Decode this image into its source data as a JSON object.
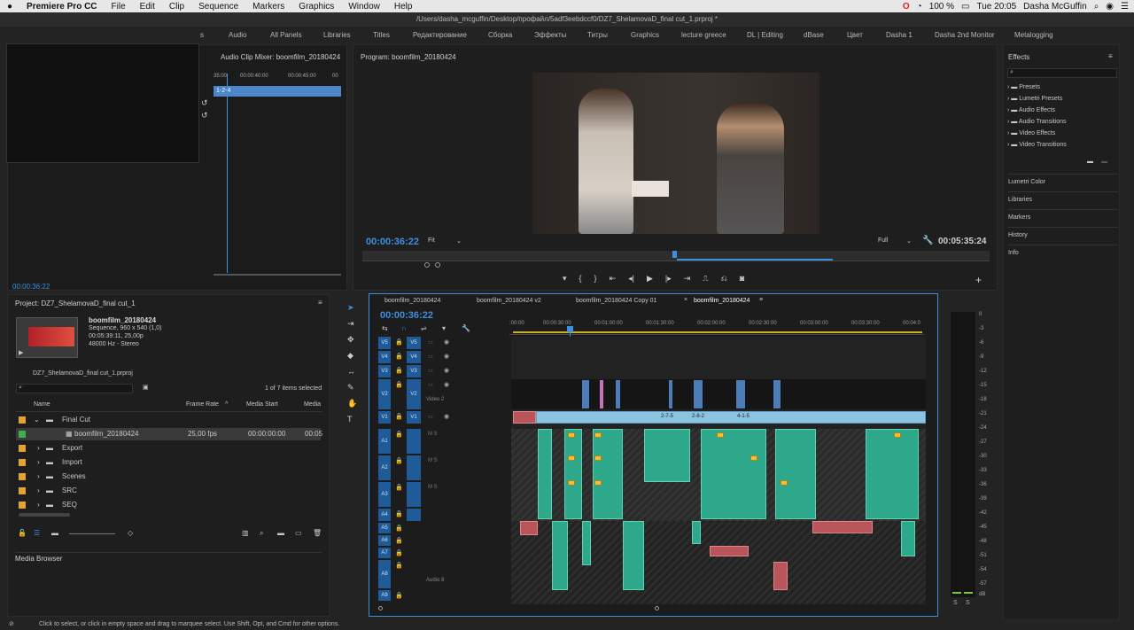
{
  "menubar": {
    "app": "Premiere Pro CC",
    "items": [
      "File",
      "Edit",
      "Clip",
      "Sequence",
      "Markers",
      "Graphics",
      "Window",
      "Help"
    ],
    "battery": "100 %",
    "time": "Tue 20:05",
    "user": "Dasha McGuffin"
  },
  "window_title": "/Users/dasha_mcguffin/Desktop/профайл/5adf3eebdccf0/DZ7_ShelamovaD_final cut_1.prproj *",
  "workspaces": [
    "s",
    "Audio",
    "All Panels",
    "Libraries",
    "Titles",
    "Редактирование",
    "Сборка",
    "Эффекты",
    "Титры",
    "Graphics",
    "lecture greece",
    "DL | Editing",
    "dBase",
    "Цвет",
    "Dasha 1",
    "Dasha 2nd Monitor",
    "Metalogging"
  ],
  "source_panel": {
    "title": "Audio Clip Mixer: boomfilm_20180424",
    "times": [
      "35:00",
      "00:00:40:00",
      "00:00:45:00",
      "00"
    ],
    "track_label": "1-2-4",
    "timecode": "00:00:36:22"
  },
  "program": {
    "title": "Program: boomfilm_20180424",
    "timecode": "00:00:36:22",
    "fit": "Fit",
    "quality": "Full",
    "duration": "00:05:35:24"
  },
  "effects_panel": {
    "title": "Effects",
    "items": [
      "Presets",
      "Lumetri Presets",
      "Audio Effects",
      "Audio Transitions",
      "Video Effects",
      "Video Transitions"
    ],
    "panels": [
      "Lumetri Color",
      "Libraries",
      "Markers",
      "History",
      "Info"
    ]
  },
  "project": {
    "title": "Project: DZ7_ShelamovaD_final cut_1",
    "seq_name": "boomfilm_20180424",
    "seq_info": [
      "Sequence, 960 x 540 (1,0)",
      "00:05:39:11, 25,00p",
      "48000 Hz - Stereo"
    ],
    "file": "DZ7_ShelamovaD_final cut_1.prproj",
    "selected": "1 of 7 items selected",
    "columns": [
      "Name",
      "Frame Rate",
      "Media Start",
      "Media"
    ],
    "rows": [
      {
        "name": "Final Cut",
        "color": "#e8a030",
        "rate": "",
        "start": ""
      },
      {
        "name": "boomfilm_20180424",
        "color": "#3cb04a",
        "rate": "25,00 fps",
        "start": "00:00:00:00",
        "media": "00:05"
      },
      {
        "name": "Export",
        "color": "#e8a030",
        "rate": "",
        "start": ""
      },
      {
        "name": "Import",
        "color": "#e8a030",
        "rate": "",
        "start": ""
      },
      {
        "name": "Scenes",
        "color": "#e8a030",
        "rate": "",
        "start": ""
      },
      {
        "name": "SRC",
        "color": "#e8a030",
        "rate": "",
        "start": ""
      },
      {
        "name": "SEQ",
        "color": "#e8a030",
        "rate": "",
        "start": ""
      }
    ],
    "media_browser": "Media Browser"
  },
  "timeline": {
    "tabs": [
      "boomfilm_20180424",
      "boomfilm_20180424 v2",
      "boomfilm_20180424 Copy 01",
      "boomfilm_20180424"
    ],
    "timecode": "00:00:36:22",
    "ruler": [
      ":00:00",
      "00:00:30:00",
      "00:01:00:00",
      "00:01:30:00",
      "00:02:00:00",
      "00:02:30:00",
      "00:03:00:00",
      "00:03:30:00",
      "00:04:0"
    ],
    "video_tracks": [
      "V5",
      "V4",
      "V3",
      "V2",
      "V1"
    ],
    "audio_tracks": [
      "A1",
      "A2",
      "A3",
      "A4",
      "A5",
      "A6",
      "A7",
      "A8",
      "A9"
    ],
    "video2_label": "Video 2",
    "audio8_label": "Audio 8",
    "v1_clip_labels": [
      "2-7-5",
      "2-8-2",
      "4-1-5"
    ]
  },
  "meter_db": [
    "0",
    "-3",
    "-6",
    "-9",
    "-12",
    "-15",
    "-18",
    "-21",
    "-24",
    "-27",
    "-30",
    "-33",
    "-36",
    "-39",
    "-42",
    "-45",
    "-48",
    "-51",
    "-54",
    "-57",
    "dB"
  ],
  "meter_buttons": [
    "S",
    "S"
  ],
  "status": "Click to select, or click in empty space and drag to marquee select. Use Shift, Opt, and Cmd for other options."
}
